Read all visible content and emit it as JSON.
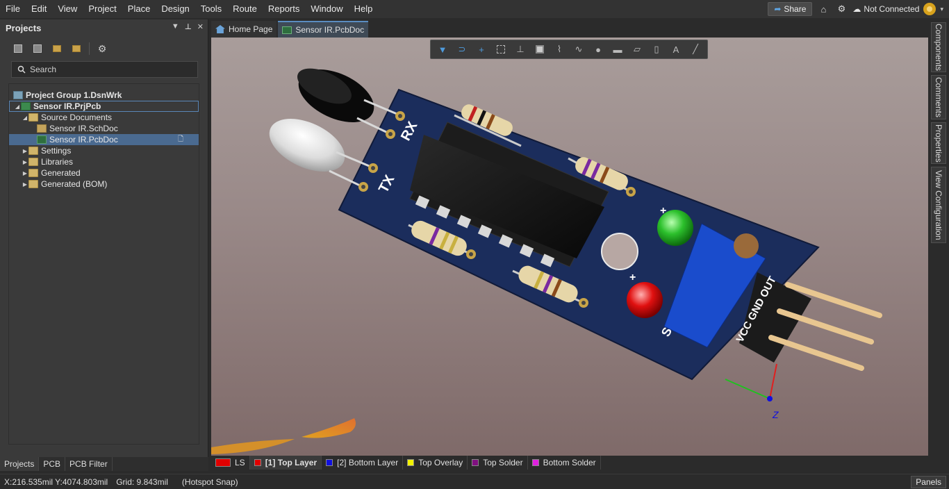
{
  "menu": [
    "File",
    "Edit",
    "View",
    "Project",
    "Place",
    "Design",
    "Tools",
    "Route",
    "Reports",
    "Window",
    "Help"
  ],
  "topright": {
    "share": "Share",
    "connection": "Not Connected"
  },
  "projects_panel": {
    "title": "Projects",
    "search_placeholder": "Search",
    "tree": [
      {
        "label": "Project Group 1.DsnWrk",
        "icon": "group-icon",
        "level": 0
      },
      {
        "label": "Sensor IR.PrjPcb",
        "icon": "project-icon",
        "level": 0
      },
      {
        "label": "Source Documents",
        "icon": "folder-icon",
        "level": 1
      },
      {
        "label": "Sensor IR.SchDoc",
        "icon": "schematic-icon",
        "level": 2
      },
      {
        "label": "Sensor IR.PcbDoc",
        "icon": "pcb-icon",
        "level": 2
      },
      {
        "label": "Settings",
        "icon": "folder-icon",
        "level": 1
      },
      {
        "label": "Libraries",
        "icon": "folder-icon",
        "level": 1
      },
      {
        "label": "Generated",
        "icon": "folder-icon",
        "level": 1
      },
      {
        "label": "Generated (BOM)",
        "icon": "folder-icon",
        "level": 1
      }
    ]
  },
  "panel_tabs": [
    "Projects",
    "PCB",
    "PCB Filter"
  ],
  "doc_tabs": [
    "Home Page",
    "Sensor IR.PcbDoc"
  ],
  "right_panels": [
    "Components",
    "Comments",
    "Properties",
    "View Configuration"
  ],
  "layers": [
    {
      "label": "LS",
      "color": "#e00000"
    },
    {
      "label": "[1] Top Layer",
      "color": "#e00000"
    },
    {
      "label": "[2] Bottom Layer",
      "color": "#1010e0"
    },
    {
      "label": "Top Overlay",
      "color": "#f2f200"
    },
    {
      "label": "Top Solder",
      "color": "#801080"
    },
    {
      "label": "Bottom Solder",
      "color": "#e020e0"
    }
  ],
  "status": {
    "coords": "X:216.535mil Y:4074.803mil",
    "grid": "Grid: 9.843mil",
    "snap": "(Hotspot Snap)",
    "panels": "Panels"
  },
  "silkscreen": {
    "rx": "RX",
    "tx": "TX",
    "header": "VCC GND OUT",
    "plus": "+",
    "s": "S",
    "z_axis": "Z"
  }
}
